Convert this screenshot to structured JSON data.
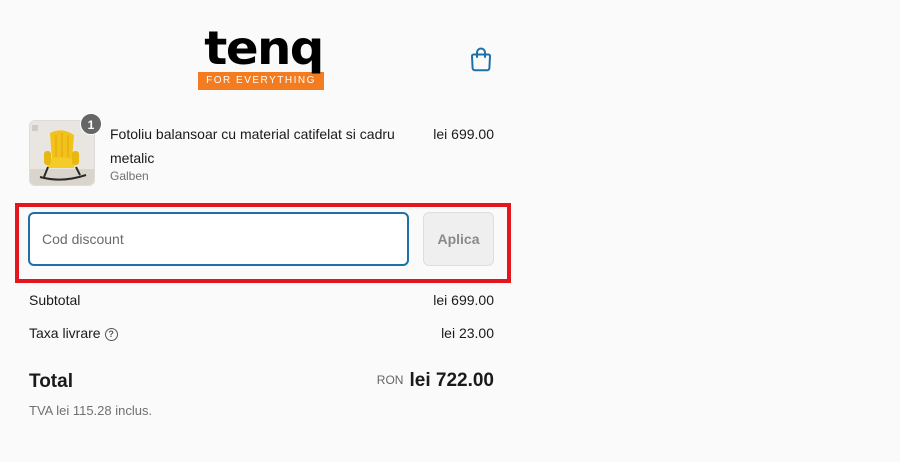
{
  "brand": {
    "name": "tenq",
    "tagline": "FOR EVERYTHING",
    "accent_color": "#f47c20"
  },
  "header": {
    "cart_icon": "shopping-bag-icon"
  },
  "cart": {
    "items": [
      {
        "quantity": "1",
        "title": "Fotoliu balansoar cu material catifelat si cadru metalic",
        "variant": "Galben",
        "price": "lei 699.00"
      }
    ]
  },
  "discount": {
    "placeholder": "Cod discount",
    "value": "",
    "apply_label": "Aplica"
  },
  "summary": {
    "subtotal_label": "Subtotal",
    "subtotal_value": "lei 699.00",
    "shipping_label": "Taxa livrare",
    "shipping_help_icon": "question-circle-icon",
    "shipping_value": "lei 23.00",
    "total_label": "Total",
    "currency": "RON",
    "total_value": "lei 722.00",
    "vat_note": "TVA lei 115.28 inclus."
  }
}
